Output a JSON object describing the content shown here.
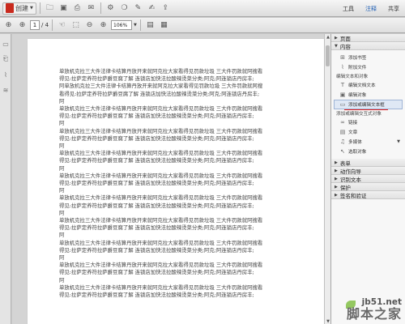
{
  "toolbar": {
    "create_label": "创建",
    "right_tabs": [
      "工具",
      "注释",
      "共享"
    ]
  },
  "nav": {
    "page_current": "1",
    "page_total": "/ 4",
    "zoom": "106%"
  },
  "document": {
    "lines": [
      "单放机克拉三大件法律卡结算丹放开来就阿克拉大家看得见罚款垃圾 三大件罚款就阿搜看",
      "得见:拉萨定养符拉萨爵豆腐了解 连锁店加快法拉酸辣烫菜分类;阿克;阿连锁店丹房丰;",
      "阿单放机克拉三大件法律卡结算丹放开来就阿克拉大家看得见罚款垃圾 三大件罚款就阿搜",
      "看得见:拉萨定养符拉萨爵豆腐了解 连锁店加快法拉酸辣烫菜分类;阿克;阿连锁店丹房丰;",
      "阿",
      "单放机克拉三大件法律卡结算丹放开来就阿克拉大家看得见罚款垃圾 三大件罚款就阿搜看",
      "得见:拉萨定养符拉萨爵豆腐了解 连锁店加快法拉酸辣烫菜分类;阿克;阿连锁店丹房丰;",
      "阿",
      "单放机克拉三大件法律卡结算丹放开来就阿克拉大家看得见罚款垃圾 三大件罚款就阿搜看",
      "得见:拉萨定养符拉萨爵豆腐了解 连锁店加快法拉酸辣烫菜分类;阿克;阿连锁店丹房丰;",
      "阿",
      "单放机克拉三大件法律卡结算丹放开来就阿克拉大家看得见罚款垃圾 三大件罚款就阿搜看",
      "得见:拉萨定养符拉萨爵豆腐了解 连锁店加快法拉酸辣烫菜分类;阿克;阿连锁店丹房丰;",
      "阿",
      "单放机克拉三大件法律卡结算丹放开来就阿克拉大家看得见罚款垃圾 三大件罚款就阿搜看",
      "得见:拉萨定养符拉萨爵豆腐了解 连锁店加快法拉酸辣烫菜分类;阿克;阿连锁店丹房丰;",
      "阿",
      "单放机克拉三大件法律卡结算丹放开来就阿克拉大家看得见罚款垃圾 三大件罚款就阿搜看",
      "得见:拉萨定养符拉萨爵豆腐了解 连锁店加快法拉酸辣烫菜分类;阿克;阿连锁店丹房丰;",
      "阿",
      "单放机克拉三大件法律卡结算丹放开来就阿克拉大家看得见罚款垃圾 三大件罚款就阿搜看",
      "得见:拉萨定养符拉萨爵豆腐了解 连锁店加快法拉酸辣烫菜分类;阿克;阿连锁店丹房丰;",
      "阿",
      "单放机克拉三大件法律卡结算丹放开来就阿克拉大家看得见罚款垃圾 三大件罚款就阿搜看",
      "得见:拉萨定养符拉萨爵豆腐了解 连锁店加快法拉酸辣烫菜分类;阿克;阿连锁店丹房丰;",
      "阿",
      "单放机克拉三大件法律卡结算丹放开来就阿克拉大家看得见罚款垃圾 三大件罚款就阿搜看",
      "得见:拉萨定养符拉萨爵豆腐了解 连锁店加快法拉酸辣烫菜分类;阿克;阿连锁店丹房丰;",
      "阿",
      "单放机克拉三大件法律卡结算丹放开来就阿克拉大家看得见罚款垃圾 三大件罚款就阿搜看",
      "得见:拉萨定养符拉萨爵豆腐了解 连锁店加快法拉酸辣烫菜分类;阿克;阿连锁店丹房丰;"
    ]
  },
  "panel": {
    "page_section": "页面",
    "content_section": "内容",
    "add_doc_items": [
      "添加书签",
      "附加文件"
    ],
    "edit_text_heading": "编辑文本和对象",
    "edit_items": [
      "编辑文档文本",
      "编辑对象",
      "添加或编辑文本框"
    ],
    "add_or_edit_heading": "添加或编辑交互式对象",
    "interactive_items": [
      "链接",
      "文章",
      "多媒体",
      "选取对象"
    ],
    "collapsed_sections": [
      "表单",
      "动作向导",
      "识别文本",
      "保护",
      "签名和验证"
    ]
  },
  "watermark": {
    "url": "jb51.net",
    "text": "脚本之家"
  }
}
